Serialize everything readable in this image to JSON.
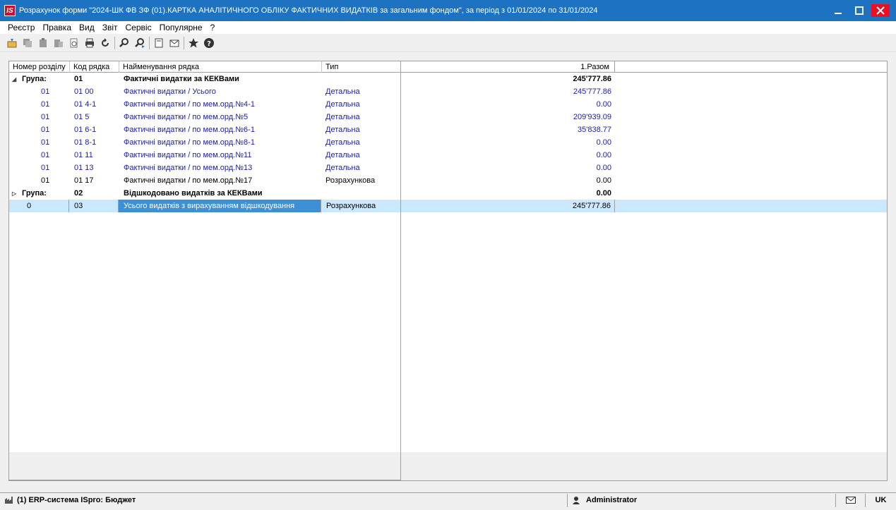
{
  "window": {
    "title": "Розрахунок форми \"2024-ШК ФВ ЗФ (01).КАРТКА АНАЛІТИЧНОГО ОБЛІКУ ФАКТИЧНИХ ВИДАТКІВ за загальним фондом\",  за період з  01/01/2024 по 31/01/2024",
    "logo": "IS"
  },
  "menu": [
    "Реєстр",
    "Правка",
    "Вид",
    "Звіт",
    "Сервіс",
    "Популярне",
    "?"
  ],
  "toolbar": [
    "open-icon",
    "copy-icon",
    "paste-icon",
    "paste-special-icon",
    "refresh-copy-icon",
    "print-icon",
    "reload-icon",
    "find-icon",
    "find-next-icon",
    "document-icon",
    "mail-icon",
    "star-icon",
    "help-icon"
  ],
  "grid": {
    "headers": {
      "section": "Номер розділу",
      "code": "Код рядка",
      "name": "Найменування рядка",
      "type": "Тип",
      "total": "1.Разом"
    },
    "rows": [
      {
        "kind": "group",
        "section": "Група:",
        "code": "01",
        "name": "Фактичні видатки за КЕКВами",
        "type": "",
        "total": "245'777.86",
        "expanded": true
      },
      {
        "kind": "detail",
        "section": "01",
        "code": "01 00",
        "name": "Фактичні видатки / Усього",
        "type": "Детальна",
        "total": "245'777.86"
      },
      {
        "kind": "detail",
        "section": "01",
        "code": "01 4-1",
        "name": "Фактичні видатки /  по мем.орд.№4-1",
        "type": "Детальна",
        "total": "0.00"
      },
      {
        "kind": "detail",
        "section": "01",
        "code": "01 5",
        "name": "Фактичні видатки /  по мем.орд.№5",
        "type": "Детальна",
        "total": "209'939.09"
      },
      {
        "kind": "detail",
        "section": "01",
        "code": "01 6-1",
        "name": "Фактичні видатки /  по мем.орд.№6-1",
        "type": "Детальна",
        "total": "35'838.77"
      },
      {
        "kind": "detail",
        "section": "01",
        "code": "01 8-1",
        "name": "Фактичні видатки /  по мем.орд.№8-1",
        "type": "Детальна",
        "total": "0.00"
      },
      {
        "kind": "detail",
        "section": "01",
        "code": "01 11",
        "name": "Фактичні видатки / по мем.орд.№11",
        "type": "Детальна",
        "total": "0.00"
      },
      {
        "kind": "detail",
        "section": "01",
        "code": "01 13",
        "name": "Фактичні видатки /  по мем.орд.№13",
        "type": "Детальна",
        "total": "0.00"
      },
      {
        "kind": "calc",
        "section": "01",
        "code": "01 17",
        "name": "Фактичні видатки / по мем.орд.№17",
        "type": "Розрахункова",
        "total": "0.00"
      },
      {
        "kind": "group",
        "section": "Група:",
        "code": "02",
        "name": "Відшкодовано видатків за КЕКВами",
        "type": "",
        "total": "0.00",
        "expanded": false
      },
      {
        "kind": "selected",
        "section": "0",
        "code": "03",
        "name": "Усього видатків з вирахуванням відшкодування",
        "type": "Розрахункова",
        "total": "245'777.86"
      }
    ]
  },
  "status": {
    "system": "(1) ERP-система ISpro: Бюджет",
    "user": "Administrator",
    "lang": "UK"
  },
  "colors": {
    "titlebar": "#1d73c2",
    "close": "#e81123",
    "link_text": "#1c22a0",
    "selection": "#cce8ff",
    "selection_cell": "#3d8fd6"
  }
}
